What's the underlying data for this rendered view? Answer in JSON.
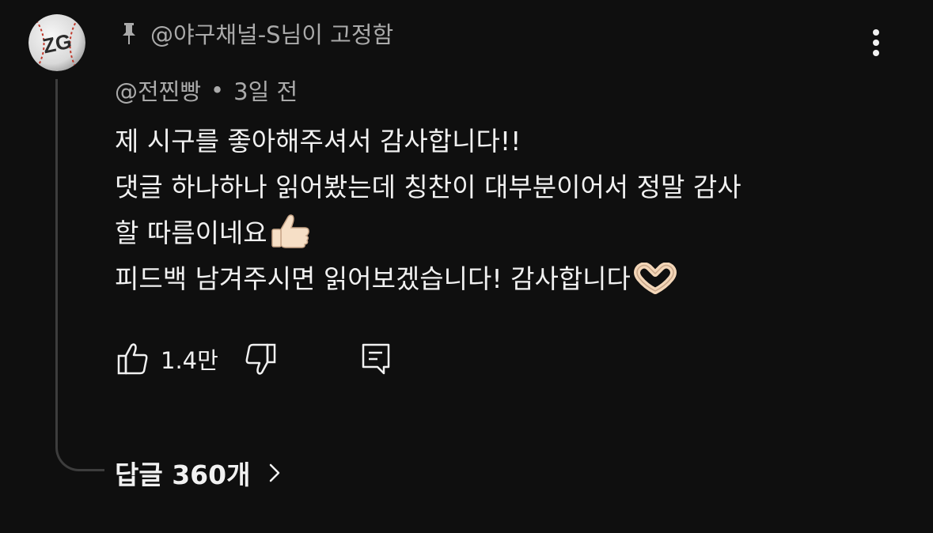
{
  "pinned": {
    "icon": "pin-icon",
    "text": "@야구채널-S님이 고정함"
  },
  "comment": {
    "author": "@전찐빵",
    "separator": "•",
    "time": "3일 전",
    "lines": [
      "제 시구를 좋아해주셔서 감사합니다!!",
      "댓글 하나하나 읽어봤는데 칭찬이 대부분이어서 정말 감사",
      "할 따름이네요",
      "피드백 남겨주시면 읽어보겠습니다! 감사합니다"
    ],
    "emojis": [
      "thumbs-up-emoji",
      "heart-hands-emoji"
    ]
  },
  "actions": {
    "like_icon": "thumbs-up-icon",
    "like_count": "1.4만",
    "dislike_icon": "thumbs-down-icon",
    "reply_icon": "comment-reply-icon"
  },
  "replies": {
    "label": "답글 360개",
    "icon": "chevron-right-icon"
  },
  "more_menu_icon": "more-vertical-icon",
  "colors": {
    "background": "#0f0f0f",
    "text_primary": "#f1f1f1",
    "text_secondary": "#aaaaaa",
    "thread_line": "#3d3d3d"
  }
}
